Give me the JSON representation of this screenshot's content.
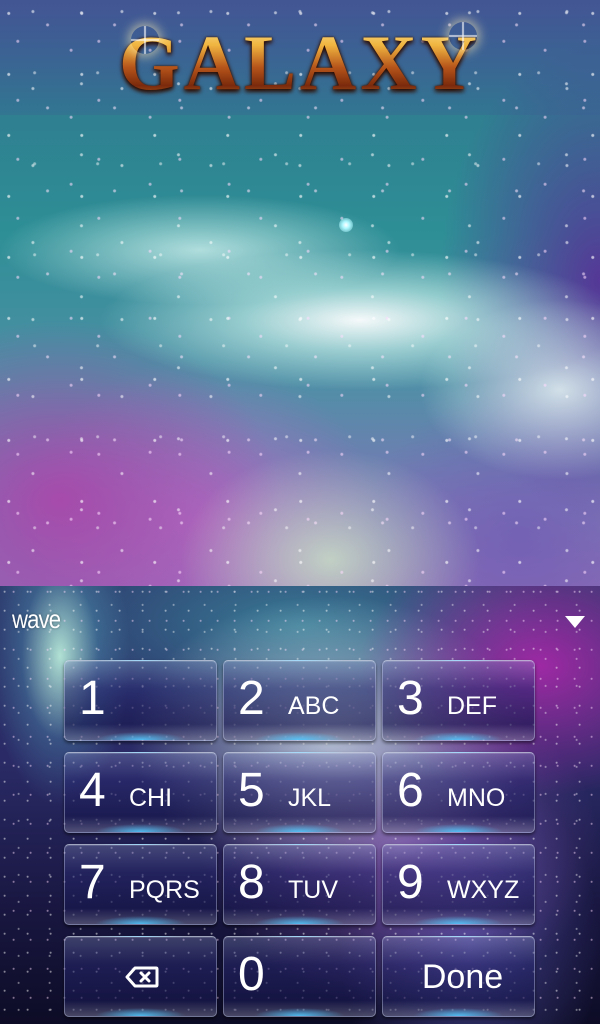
{
  "theme": {
    "title": "GALAXY",
    "accent_gold": "#d98a2a",
    "key_glow": "#50c8ff"
  },
  "input": {
    "typed_text": "wave",
    "collapse_icon": "chevron-down-icon"
  },
  "keypad": {
    "keys": [
      {
        "digit": "1",
        "letters": ""
      },
      {
        "digit": "2",
        "letters": "ABC"
      },
      {
        "digit": "3",
        "letters": "DEF"
      },
      {
        "digit": "4",
        "letters": "CHI"
      },
      {
        "digit": "5",
        "letters": "JKL"
      },
      {
        "digit": "6",
        "letters": "MNO"
      },
      {
        "digit": "7",
        "letters": "PQRS"
      },
      {
        "digit": "8",
        "letters": "TUV"
      },
      {
        "digit": "9",
        "letters": "WXYZ"
      },
      {
        "digit": "0",
        "letters": ""
      }
    ],
    "backspace_icon": "backspace-icon",
    "done_label": "Done"
  }
}
